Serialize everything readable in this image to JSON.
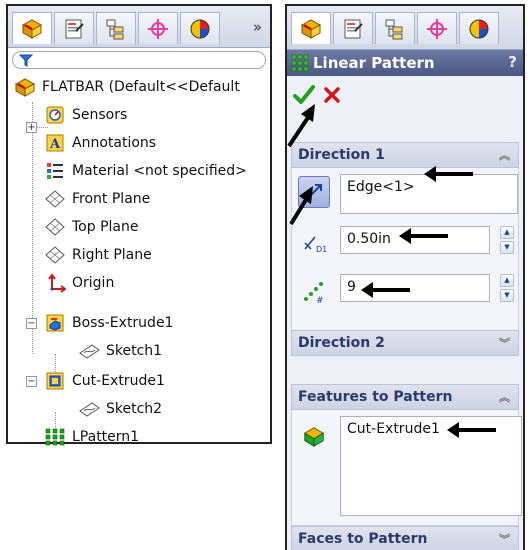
{
  "tree": {
    "filter_icon": "funnel-icon",
    "more_label": "»",
    "root": "FLATBAR  (Default<<Default",
    "items": [
      {
        "label": "Sensors",
        "icon": "sensors-icon"
      },
      {
        "label": "Annotations",
        "icon": "annotations-icon",
        "expander": "+"
      },
      {
        "label": "Material <not specified>",
        "icon": "material-icon"
      },
      {
        "label": "Front Plane",
        "icon": "plane-icon"
      },
      {
        "label": "Top Plane",
        "icon": "plane-icon"
      },
      {
        "label": "Right Plane",
        "icon": "plane-icon"
      },
      {
        "label": "Origin",
        "icon": "origin-icon"
      },
      {
        "label": "Boss-Extrude1",
        "icon": "boss-extrude-icon",
        "expander": "−"
      },
      {
        "label": "Sketch1",
        "icon": "sketch-icon"
      },
      {
        "label": "Cut-Extrude1",
        "icon": "cut-extrude-icon",
        "expander": "−"
      },
      {
        "label": "Sketch2",
        "icon": "sketch-icon"
      },
      {
        "label": "LPattern1",
        "icon": "linear-pattern-icon"
      }
    ]
  },
  "property_manager": {
    "title": "Linear Pattern",
    "help": "?",
    "ok_icon": "checkmark-icon",
    "cancel_icon": "x-cancel-icon",
    "direction1": {
      "header": "Direction 1",
      "edge": "Edge<1>",
      "spacing": "0.50in",
      "instances": "9"
    },
    "direction2": {
      "header": "Direction 2"
    },
    "features": {
      "header": "Features to Pattern",
      "item": "Cut-Extrude1"
    },
    "faces": {
      "header": "Faces to Pattern"
    }
  },
  "colors": {
    "title_bar": "#4b5784",
    "group_header_text": "#2b3a6b",
    "ok_green": "#1fa319",
    "cancel_red": "#d01818"
  }
}
